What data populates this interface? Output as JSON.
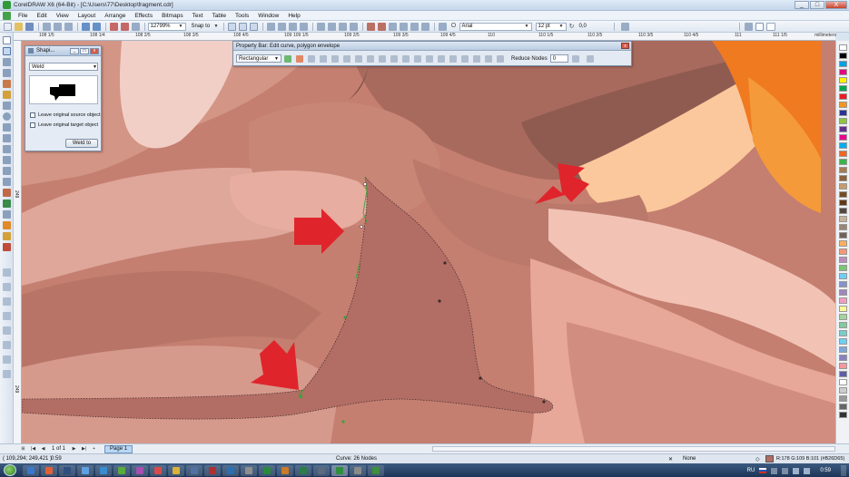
{
  "window": {
    "title": "CorelDRAW X6 (64-Bit) - [C:\\Users\\77\\Desktop\\fragment.cdr]",
    "minimize": "_",
    "maximize": "□",
    "close": "X"
  },
  "menu": [
    "File",
    "Edit",
    "View",
    "Layout",
    "Arrange",
    "Effects",
    "Bitmaps",
    "Text",
    "Table",
    "Tools",
    "Window",
    "Help"
  ],
  "toolbar": {
    "zoom": "12799%",
    "snap_to": "Snap to",
    "font": "Arial",
    "font_size": "12 pt",
    "rotation": "0,0"
  },
  "ruler": {
    "top_ticks": [
      "108 1/5",
      "108 1/4",
      "108 2/5",
      "108 3/5",
      "108 4/5",
      "109",
      "109 1/5",
      "109 2/5",
      "109 3/5",
      "109 4/5",
      "110",
      "110 1/5",
      "110 2/5",
      "110 3/5",
      "110 4/5",
      "111",
      "111 1/5"
    ],
    "unit": "millimeters",
    "left_ticks": [
      "249",
      "249"
    ]
  },
  "shaping_docker": {
    "title": "Shapi...",
    "mode": "Weld",
    "leave_source": "Leave original source object",
    "leave_target": "Leave original target object",
    "weld_button": "Weld to"
  },
  "property_bar": {
    "title": "Property Bar: Edit curve, polygon  envelope",
    "mode": "Rectangular",
    "reduce_nodes_label": "Reduce Nodes",
    "reduce_nodes_value": "0"
  },
  "page_bar": {
    "page_count": "1 of 1",
    "page_tab": "Page 1"
  },
  "status": {
    "coords": "( 109,294; 249,421 )",
    "time": "0:59",
    "info": "Curve: 26 Nodes",
    "outline": "None",
    "fill": "R:178 G:109 B:101 (#B26D65)",
    "fill_color": "#b26d65"
  },
  "taskbar": {
    "lang": "RU",
    "clock": "0:59",
    "apps": [
      "#3a78c9",
      "#e0603a",
      "#2f4f7f",
      "#5fa0e0",
      "#3a8cd1",
      "#5aaa3c",
      "#a64fb0",
      "#d94b4b",
      "#d8b23a",
      "#5270a0",
      "#b03030",
      "#2b6fb5",
      "#8e8e8e",
      "#2a8a3a",
      "#c97a2a",
      "#2c7d4a",
      "#5a6a80",
      "#2f8f3f",
      "#8a8a8a",
      "#3c8f3c"
    ]
  },
  "palette": [
    "#ffffff",
    "#000000",
    "#00a0e3",
    "#e4007f",
    "#fff100",
    "#00a651",
    "#ed1c24",
    "#f7941d",
    "#2e3192",
    "#8dc63f",
    "#662d91",
    "#ec008c",
    "#00aeef",
    "#f26522",
    "#39b54a",
    "#a67c52",
    "#8c6239",
    "#c69c6d",
    "#754c24",
    "#603913",
    "#534741",
    "#c7b299",
    "#998675",
    "#736357",
    "#fbaf5d",
    "#f69679",
    "#bd8cbf",
    "#7cc576",
    "#6dcff6",
    "#8393ca",
    "#a186be",
    "#f49ac2",
    "#fff799",
    "#a3d39c",
    "#82ca9c",
    "#7accc8",
    "#6dcff6",
    "#7da7d9",
    "#8781bd",
    "#f5989d",
    "#605ca8",
    "#ffffff",
    "#cccccc",
    "#999999",
    "#666666",
    "#333333"
  ]
}
